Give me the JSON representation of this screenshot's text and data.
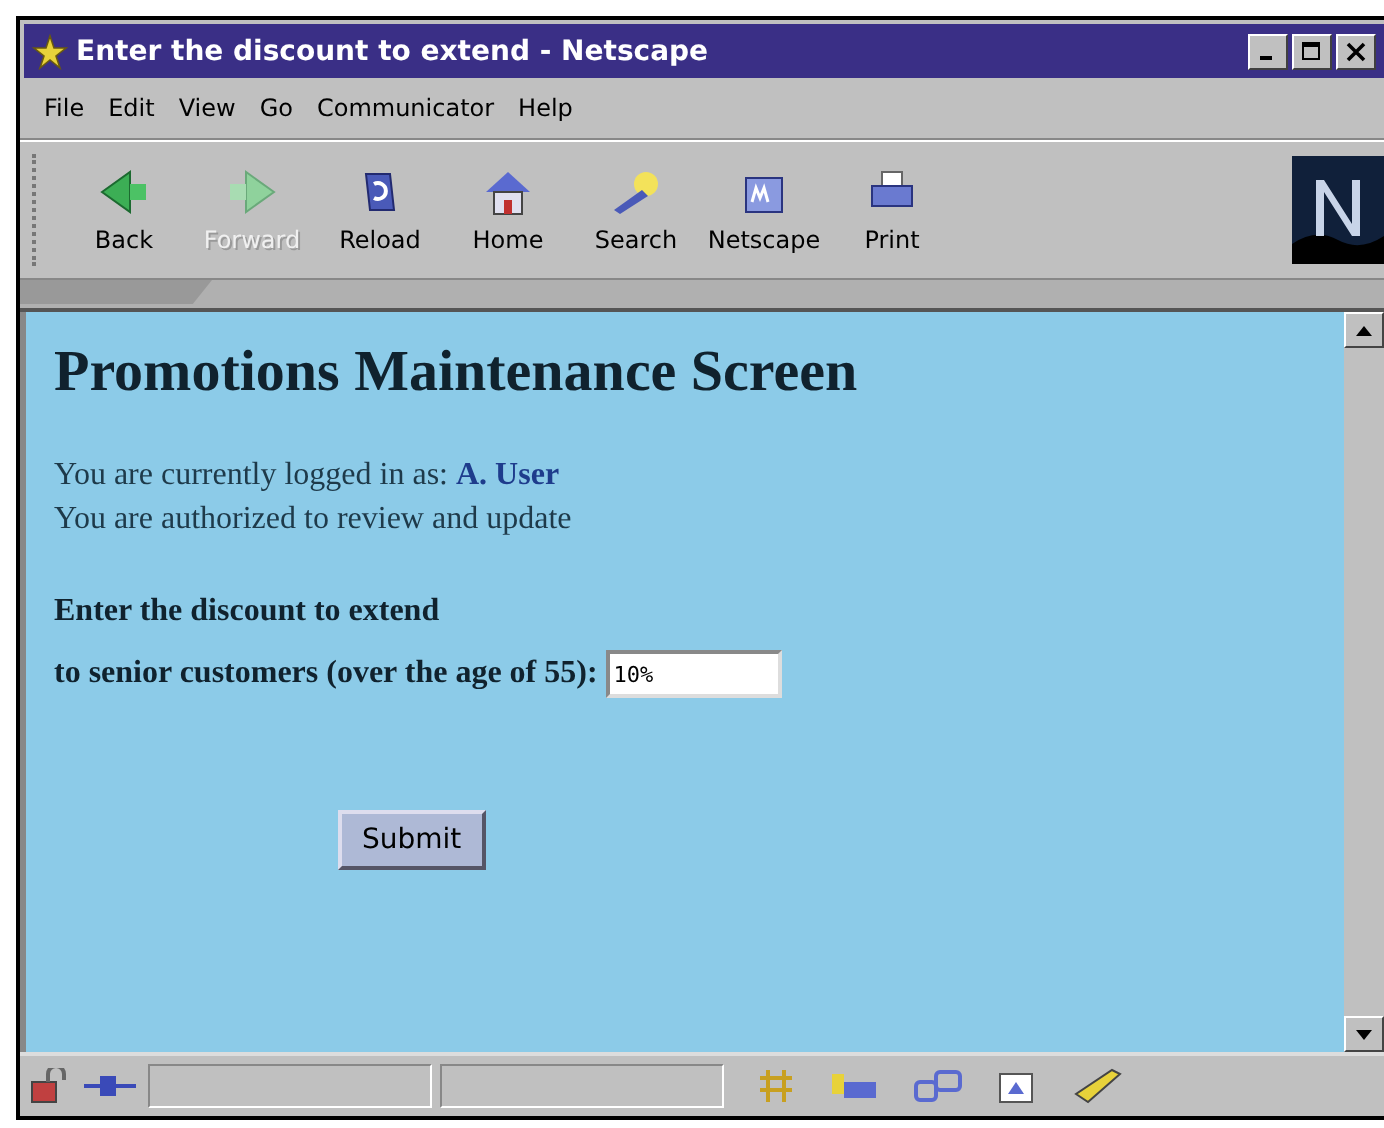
{
  "window": {
    "title": "Enter the discount to extend - Netscape"
  },
  "menu": [
    "File",
    "Edit",
    "View",
    "Go",
    "Communicator",
    "Help"
  ],
  "toolbar": [
    {
      "label": "Back",
      "kind": "back",
      "disabled": false
    },
    {
      "label": "Forward",
      "kind": "forward",
      "disabled": true
    },
    {
      "label": "Reload",
      "kind": "reload",
      "disabled": false
    },
    {
      "label": "Home",
      "kind": "home",
      "disabled": false
    },
    {
      "label": "Search",
      "kind": "search",
      "disabled": false
    },
    {
      "label": "Netscape",
      "kind": "netscape",
      "disabled": false
    },
    {
      "label": "Print",
      "kind": "print",
      "disabled": false
    }
  ],
  "page": {
    "heading": "Promotions Maintenance Screen",
    "login_text": "You are currently logged in as:",
    "user": "A. User",
    "auth_text": "You are authorized to review and update",
    "prompt_line_1": "Enter the discount to extend",
    "prompt_line_2": "to senior customers (over the age of 55):",
    "discount_value": "10%",
    "submit": "Submit"
  }
}
